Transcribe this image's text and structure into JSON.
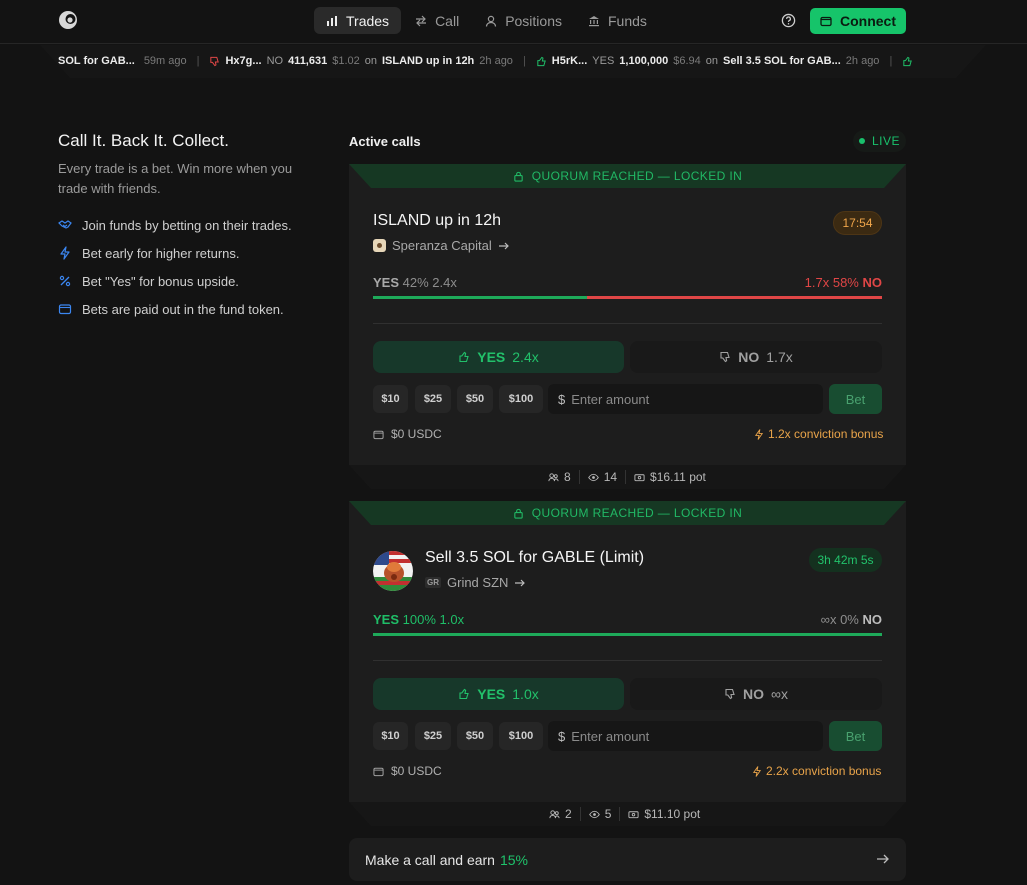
{
  "nav": {
    "items": [
      {
        "label": "Trades",
        "icon": "bar-chart-icon",
        "active": true
      },
      {
        "label": "Call",
        "icon": "swap-arrows-icon",
        "active": false
      },
      {
        "label": "Positions",
        "icon": "person-icon",
        "active": false
      },
      {
        "label": "Funds",
        "icon": "bank-icon",
        "active": false
      }
    ],
    "connect_label": "Connect"
  },
  "ticker": [
    {
      "prefix": "SOL for GAB...",
      "time": "59m ago"
    },
    {
      "user": "Hx7g...",
      "side": "NO",
      "amount": "411,631",
      "value": "$1.02",
      "on": "on",
      "market": "ISLAND up in 12h",
      "time": "2h ago"
    },
    {
      "user": "H5rK...",
      "side": "YES",
      "amount": "1,100,000",
      "value": "$6.94",
      "on": "on",
      "market": "Sell 3.5 SOL for GAB...",
      "time": "2h ago"
    }
  ],
  "intro": {
    "title": "Call It. Back It. Collect.",
    "subtitle": "Every trade is a bet. Win more when you trade with friends.",
    "features": [
      {
        "icon": "handshake-icon",
        "text": "Join funds by betting on their trades."
      },
      {
        "icon": "lightning-icon",
        "text": "Bet early for higher returns."
      },
      {
        "icon": "percent-icon",
        "text": "Bet \"Yes\" for bonus upside."
      },
      {
        "icon": "wallet-icon",
        "text": "Bets are paid out in the fund token."
      }
    ]
  },
  "active_calls": {
    "title": "Active calls",
    "live_label": "LIVE"
  },
  "cards": [
    {
      "quorum": "QUORUM REACHED — LOCKED IN",
      "title": "ISLAND up in 12h",
      "fund": "Speranza Capital",
      "timer": "17:54",
      "yes_label": "YES",
      "yes_pct": "42%",
      "yes_mult": "2.4x",
      "no_label": "NO",
      "no_pct": "58%",
      "no_mult": "1.7x",
      "yes_fraction": 0.42,
      "vote_yes": {
        "label": "YES",
        "mult": "2.4x"
      },
      "vote_no": {
        "label": "NO",
        "mult": "1.7x"
      },
      "chips": [
        "$10",
        "$25",
        "$50",
        "$100"
      ],
      "amount_symbol": "$",
      "amount_placeholder": "Enter amount",
      "bet_label": "Bet",
      "balance": "$0 USDC",
      "bonus": "1.2x conviction bonus",
      "stats": {
        "participants": "8",
        "views": "14",
        "pot": "$16.11 pot"
      }
    },
    {
      "quorum": "QUORUM REACHED — LOCKED IN",
      "title": "Sell 3.5 SOL for GABLE (Limit)",
      "fund_tag": "GR",
      "fund": "Grind SZN",
      "timer": "3h 42m 5s",
      "yes_label": "YES",
      "yes_pct": "100%",
      "yes_mult": "1.0x",
      "no_label": "NO",
      "no_pct": "0%",
      "no_mult": "∞x",
      "yes_fraction": 1.0,
      "vote_yes": {
        "label": "YES",
        "mult": "1.0x"
      },
      "vote_no": {
        "label": "NO",
        "mult": "∞x"
      },
      "chips": [
        "$10",
        "$25",
        "$50",
        "$100"
      ],
      "amount_symbol": "$",
      "amount_placeholder": "Enter amount",
      "bet_label": "Bet",
      "balance": "$0 USDC",
      "bonus": "2.2x conviction bonus",
      "stats": {
        "participants": "2",
        "views": "5",
        "pot": "$11.10 pot"
      }
    }
  ],
  "earn": {
    "text": "Make a call and earn",
    "pct": "15%"
  }
}
